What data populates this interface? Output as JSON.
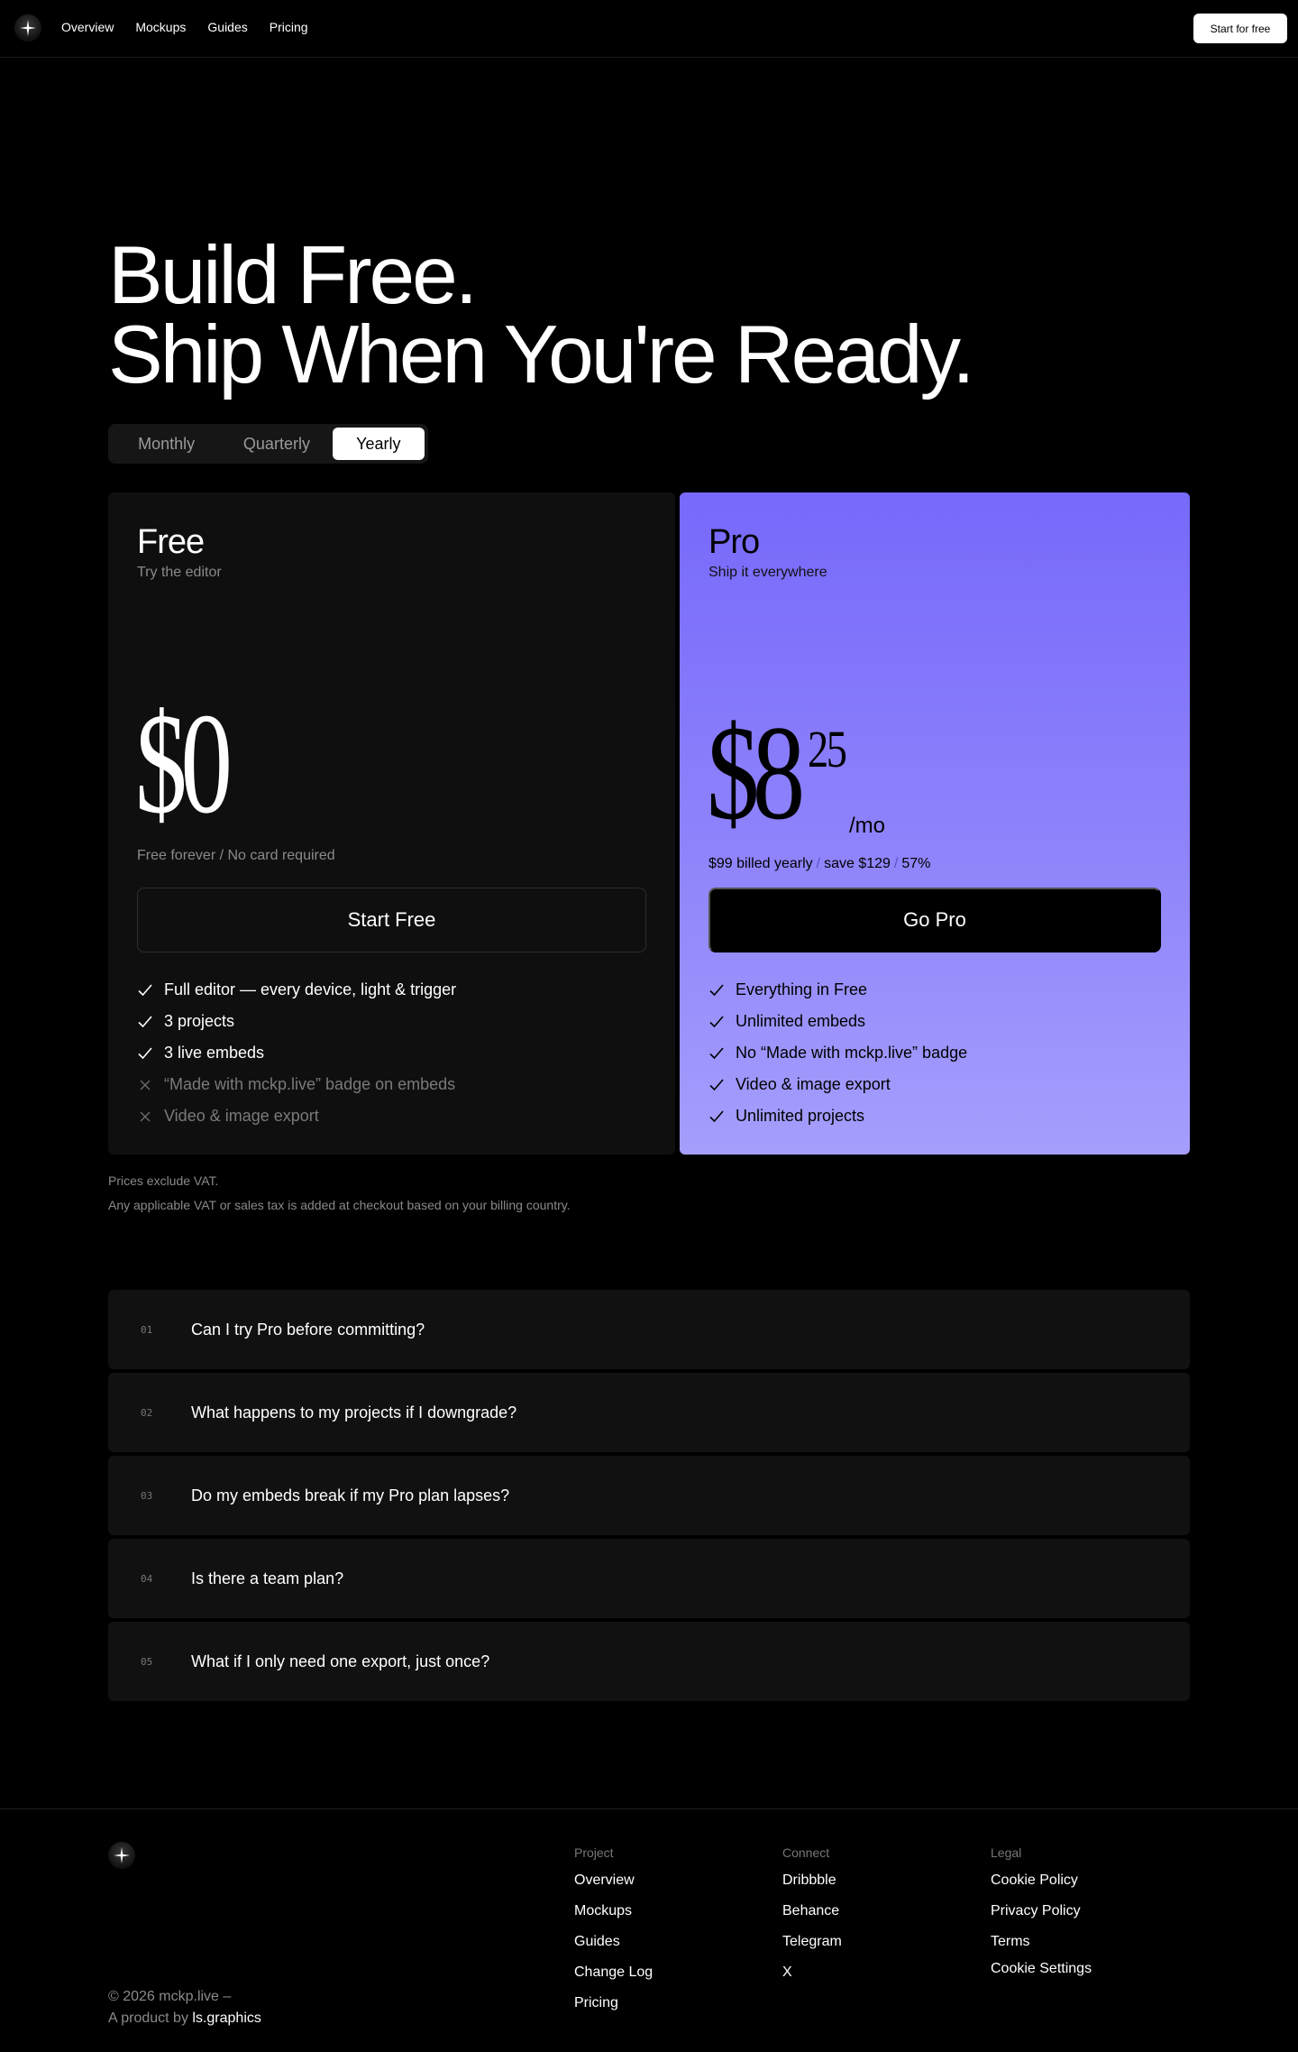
{
  "nav": {
    "links": [
      "Overview",
      "Mockups",
      "Guides",
      "Pricing"
    ],
    "cta": "Start for free"
  },
  "hero": {
    "line1": "Build Free.",
    "line2": "Ship When You're Ready."
  },
  "billing_toggle": {
    "options": [
      "Monthly",
      "Quarterly",
      "Yearly"
    ],
    "selected": "Yearly"
  },
  "plans": {
    "free": {
      "name": "Free",
      "tagline": "Try the editor",
      "price": "$0",
      "note": "Free forever / No card required",
      "button": "Start Free",
      "features": [
        {
          "text": "Full editor — every device, light & trigger",
          "included": true
        },
        {
          "text": "3 projects",
          "included": true
        },
        {
          "text": "3 live embeds",
          "included": true
        },
        {
          "text": "“Made with mckp.live” badge on embeds",
          "included": false
        },
        {
          "text": "Video & image export",
          "included": false
        }
      ]
    },
    "pro": {
      "name": "Pro",
      "tagline": "Ship it everywhere",
      "price_whole": "$8",
      "price_cents": "25",
      "per": "/mo",
      "billed": "$99 billed yearly",
      "save": "save $129",
      "discount": "57%",
      "button": "Go Pro",
      "features": [
        {
          "text": "Everything in Free",
          "included": true
        },
        {
          "text": "Unlimited embeds",
          "included": true
        },
        {
          "text": "No “Made with mckp.live” badge",
          "included": true
        },
        {
          "text": "Video & image export",
          "included": true
        },
        {
          "text": "Unlimited projects",
          "included": true
        }
      ]
    }
  },
  "vat": {
    "line1": "Prices exclude VAT.",
    "line2": "Any applicable VAT or sales tax is added at checkout based on your billing country."
  },
  "faq": [
    {
      "num": "01",
      "question": "Can I try Pro before committing?"
    },
    {
      "num": "02",
      "question": "What happens to my projects if I downgrade?"
    },
    {
      "num": "03",
      "question": "Do my embeds break if my Pro plan lapses?"
    },
    {
      "num": "04",
      "question": "Is there a team plan?"
    },
    {
      "num": "05",
      "question": "What if I only need one export, just once?"
    }
  ],
  "footer": {
    "copyright": "© 2026 mckp.live –",
    "product_prefix": "A product by",
    "product_by": "ls.graphics",
    "columns": {
      "project": {
        "heading": "Project",
        "links": [
          "Overview",
          "Mockups",
          "Guides",
          "Change Log",
          "Pricing"
        ]
      },
      "connect": {
        "heading": "Connect",
        "links": [
          "Dribbble",
          "Behance",
          "Telegram",
          "X"
        ]
      },
      "legal": {
        "heading": "Legal",
        "links": [
          "Cookie Policy",
          "Privacy Policy",
          "Terms"
        ],
        "cookie_settings": "Cookie Settings"
      }
    }
  }
}
